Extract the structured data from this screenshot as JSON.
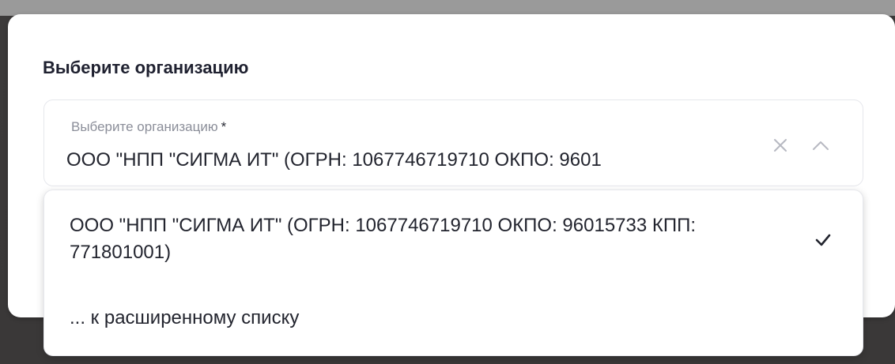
{
  "modal": {
    "title": "Выберите организацию"
  },
  "select": {
    "label": "Выберите организацию",
    "required_mark": "*",
    "value": "ООО \"НПП \"СИГМА ИТ\" (ОГРН: 1067746719710 ОКПО: 9601",
    "clear_icon": "close-icon",
    "toggle_icon": "chevron-up-icon"
  },
  "dropdown": {
    "options": [
      {
        "label": "ООО \"НПП \"СИГМА ИТ\" (ОГРН: 1067746719710 ОКПО: 96015733 КПП: 771801001)",
        "selected": true,
        "icon": "check-icon"
      },
      {
        "label": "... к расширенному списку",
        "selected": false
      }
    ]
  },
  "colors": {
    "text": "#22242e",
    "label": "#8b8e99",
    "border": "#e6e7ec",
    "icon_muted": "#b7b9c2"
  }
}
